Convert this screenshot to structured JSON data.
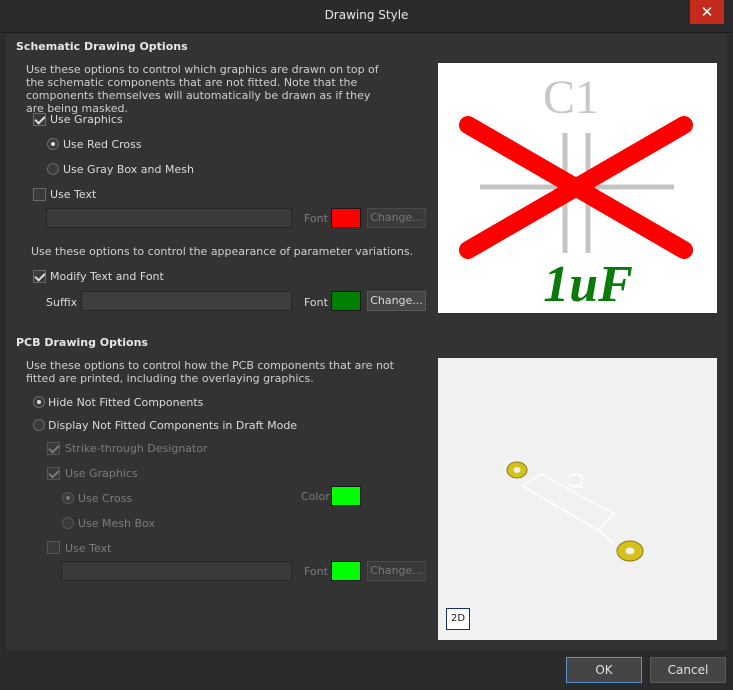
{
  "window": {
    "title": "Drawing Style",
    "close_glyph": "✕"
  },
  "schematic": {
    "section_title": "Schematic Drawing Options",
    "description_1": "Use these options to control which graphics are drawn on top of the schematic components that are not fitted. Note that the components themselves will automatically be drawn as if they are being masked.",
    "use_graphics": {
      "label": "Use Graphics",
      "checked": true
    },
    "use_red_cross": {
      "label": "Use Red Cross",
      "selected": true
    },
    "use_gray_box": {
      "label": "Use Gray Box and Mesh",
      "selected": false
    },
    "use_text": {
      "label": "Use Text",
      "checked": false
    },
    "text_font_label": "Font",
    "text_font_color": "#ff0000",
    "change_label": "Change...",
    "description_2": "Use these options to control the appearance of parameter variations.",
    "modify_text_font": {
      "label": "Modify Text and Font",
      "checked": true
    },
    "suffix_label": "Suffix",
    "suffix_value": "",
    "param_font_label": "Font",
    "param_font_color": "#008000",
    "param_change_label": "Change...",
    "preview": {
      "designator": "C1",
      "value": "1uF",
      "cross_color": "#ff0000",
      "value_color": "#0a7a0a"
    }
  },
  "pcb": {
    "section_title": "PCB Drawing Options",
    "description": "Use these options to control how the PCB components that are not fitted are printed, including the overlaying graphics.",
    "hide_not_fitted": {
      "label": "Hide Not Fitted Components",
      "selected": true
    },
    "display_draft": {
      "label": "Display Not Fitted Components in Draft Mode",
      "selected": false
    },
    "strike_through": {
      "label": "Strike-through Designator",
      "checked": true
    },
    "use_graphics": {
      "label": "Use Graphics",
      "checked": true
    },
    "use_cross": {
      "label": "Use Cross",
      "selected": true
    },
    "use_mesh_box": {
      "label": "Use Mesh Box",
      "selected": false
    },
    "color_label": "Color",
    "cross_color": "#00ff00",
    "use_text": {
      "label": "Use Text",
      "checked": false
    },
    "text_font_label": "Font",
    "text_font_color": "#00ff00",
    "change_label": "Change...",
    "view_mode_label": "2D"
  },
  "footer": {
    "ok_label": "OK",
    "cancel_label": "Cancel"
  }
}
